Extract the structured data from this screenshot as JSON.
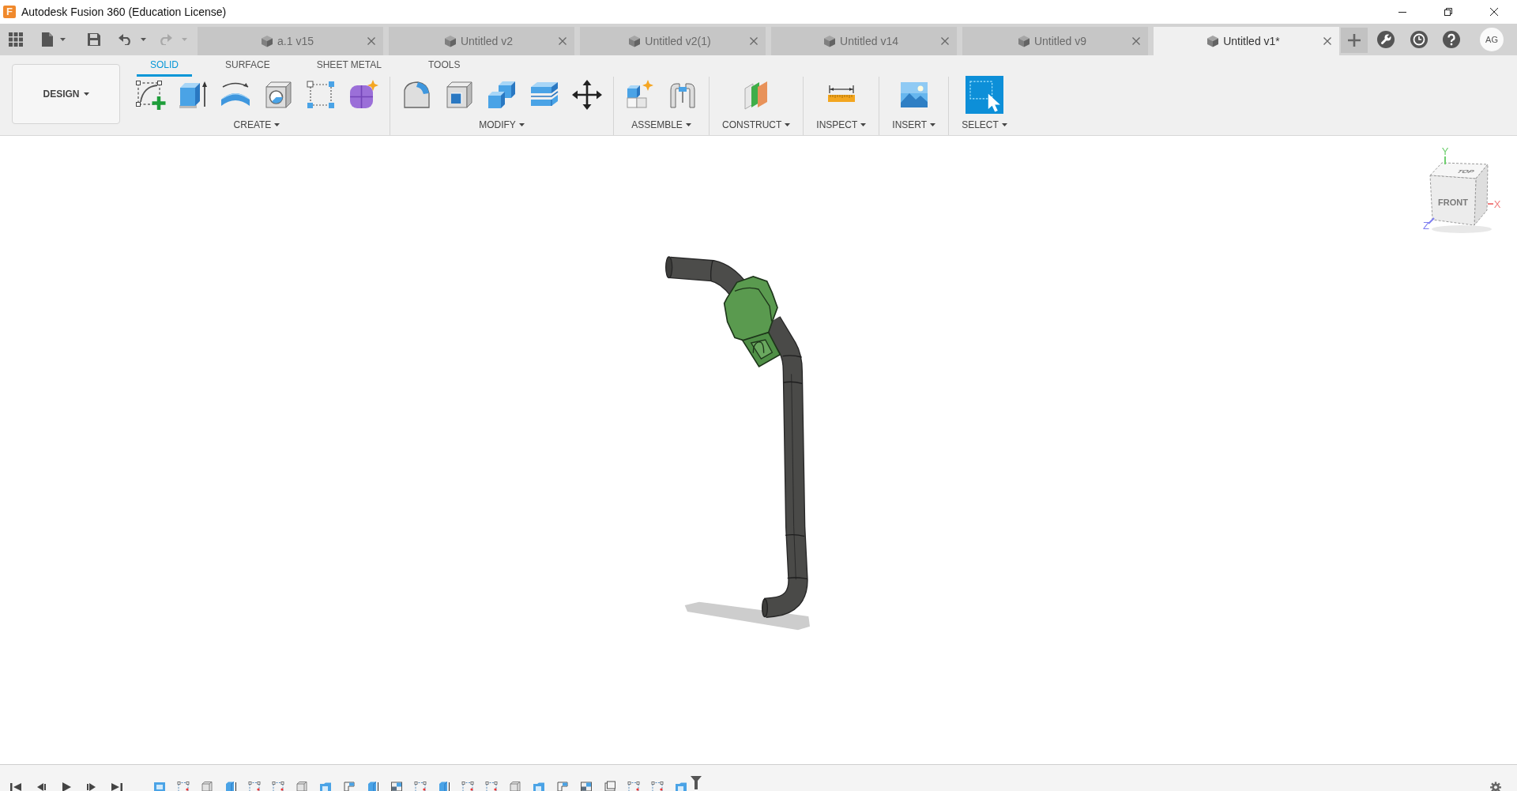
{
  "window": {
    "logo": "F",
    "title": "Autodesk Fusion 360 (Education License)"
  },
  "quick_access": [
    {
      "kind": "undo",
      "disabled": false
    },
    {
      "kind": "redo",
      "disabled": true
    }
  ],
  "tabs": [
    {
      "label": "a.1 v15",
      "selected": false
    },
    {
      "label": "Untitled v2",
      "selected": false
    },
    {
      "label": "Untitled v2(1)",
      "selected": false
    },
    {
      "label": "Untitled v14",
      "selected": false
    },
    {
      "label": "Untitled v9",
      "selected": false
    },
    {
      "label": "Untitled v1*",
      "selected": true
    }
  ],
  "user": {
    "initials": "AG"
  },
  "workspace": {
    "label": "DESIGN"
  },
  "toolbar_tabs": [
    {
      "label": "SOLID",
      "selected": true
    },
    {
      "label": "SURFACE",
      "selected": false
    },
    {
      "label": "SHEET METAL",
      "selected": false
    },
    {
      "label": "TOOLS",
      "selected": false
    }
  ],
  "tool_groups": [
    {
      "label": "CREATE"
    },
    {
      "label": "MODIFY"
    },
    {
      "label": "ASSEMBLE"
    },
    {
      "label": "CONSTRUCT"
    },
    {
      "label": "INSPECT"
    },
    {
      "label": "INSERT"
    },
    {
      "label": "SELECT"
    }
  ],
  "view_cube": {
    "faces": [
      {
        "label": "FRONT"
      },
      {
        "label": "TOP"
      }
    ],
    "axes": [
      {
        "label": "Y",
        "color": "#6fcf6f"
      },
      {
        "label": "X",
        "color": "#f07f7f"
      },
      {
        "label": "Z",
        "color": "#7f7ff0"
      }
    ]
  }
}
